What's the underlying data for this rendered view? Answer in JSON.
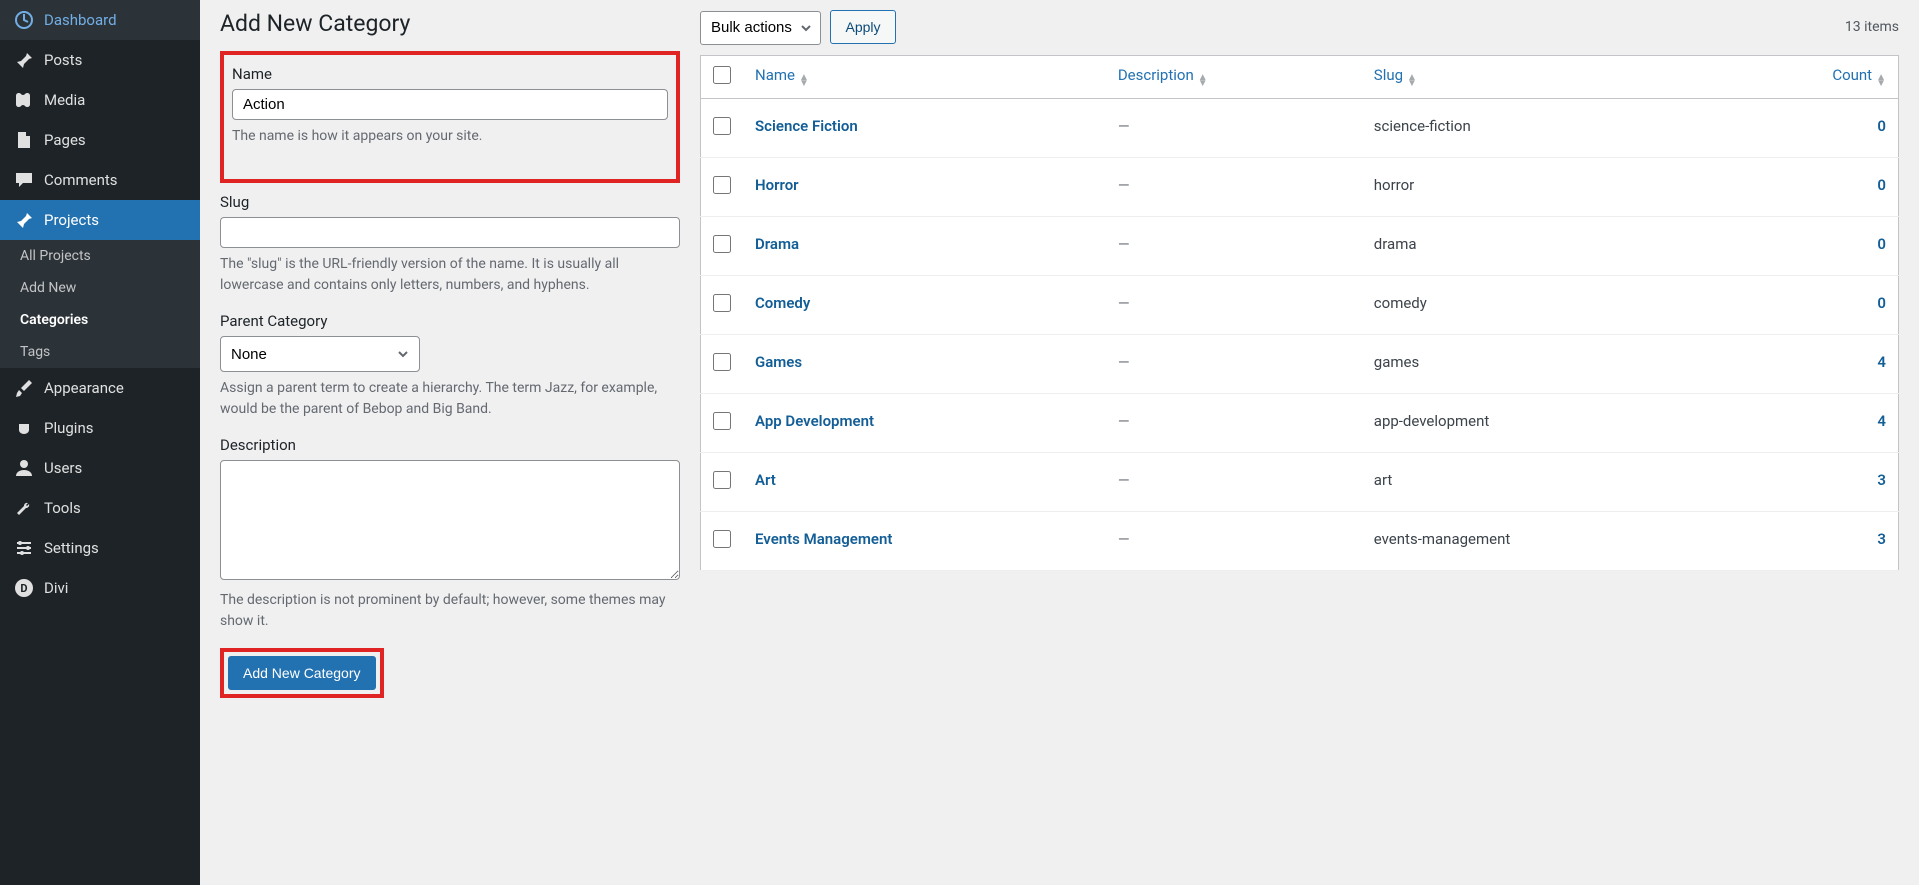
{
  "sidebar": {
    "items": [
      {
        "label": "Dashboard",
        "icon": "dashboard"
      },
      {
        "label": "Posts",
        "icon": "pin"
      },
      {
        "label": "Media",
        "icon": "media"
      },
      {
        "label": "Pages",
        "icon": "page"
      },
      {
        "label": "Comments",
        "icon": "comment"
      },
      {
        "label": "Projects",
        "icon": "pin",
        "active": true
      },
      {
        "label": "Appearance",
        "icon": "brush"
      },
      {
        "label": "Plugins",
        "icon": "plug"
      },
      {
        "label": "Users",
        "icon": "user"
      },
      {
        "label": "Tools",
        "icon": "wrench"
      },
      {
        "label": "Settings",
        "icon": "sliders"
      },
      {
        "label": "Divi",
        "icon": "divi"
      }
    ],
    "submenu": [
      {
        "label": "All Projects"
      },
      {
        "label": "Add New"
      },
      {
        "label": "Categories",
        "current": true
      },
      {
        "label": "Tags"
      }
    ]
  },
  "form": {
    "title": "Add New Category",
    "name_label": "Name",
    "name_value": "Action",
    "name_help": "The name is how it appears on your site.",
    "slug_label": "Slug",
    "slug_value": "",
    "slug_help": "The \"slug\" is the URL-friendly version of the name. It is usually all lowercase and contains only letters, numbers, and hyphens.",
    "parent_label": "Parent Category",
    "parent_value": "None",
    "parent_help": "Assign a parent term to create a hierarchy. The term Jazz, for example, would be the parent of Bebop and Big Band.",
    "desc_label": "Description",
    "desc_value": "",
    "desc_help": "The description is not prominent by default; however, some themes may show it.",
    "submit_label": "Add New Category"
  },
  "table": {
    "bulk_label": "Bulk actions",
    "apply_label": "Apply",
    "items_count": "13 items",
    "columns": {
      "name": "Name",
      "description": "Description",
      "slug": "Slug",
      "count": "Count"
    },
    "rows": [
      {
        "name": "Science Fiction",
        "desc": "—",
        "slug": "science-fiction",
        "count": "0"
      },
      {
        "name": "Horror",
        "desc": "—",
        "slug": "horror",
        "count": "0"
      },
      {
        "name": "Drama",
        "desc": "—",
        "slug": "drama",
        "count": "0"
      },
      {
        "name": "Comedy",
        "desc": "—",
        "slug": "comedy",
        "count": "0"
      },
      {
        "name": "Games",
        "desc": "—",
        "slug": "games",
        "count": "4"
      },
      {
        "name": "App Development",
        "desc": "—",
        "slug": "app-development",
        "count": "4"
      },
      {
        "name": "Art",
        "desc": "—",
        "slug": "art",
        "count": "3"
      },
      {
        "name": "Events Management",
        "desc": "—",
        "slug": "events-management",
        "count": "3"
      }
    ]
  }
}
